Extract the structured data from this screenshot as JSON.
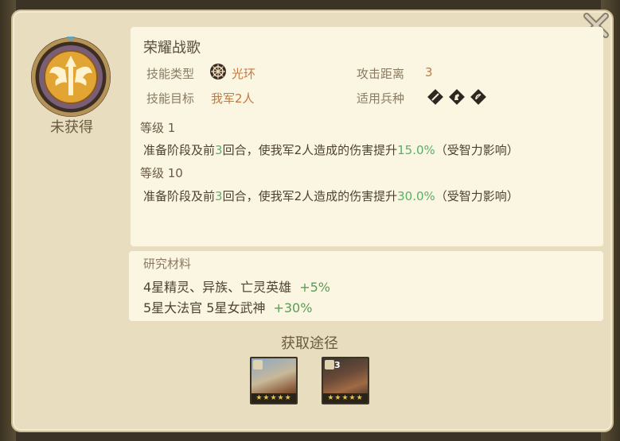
{
  "skill": {
    "name": "荣耀战歌",
    "status": "未获得",
    "type_label": "技能类型",
    "type_value": "光环",
    "range_label": "攻击距离",
    "range_value": "3",
    "target_label": "技能目标",
    "target_value": "我军2人",
    "troop_label": "适用兵种",
    "troop_icons": [
      "sword-icon",
      "horse-icon",
      "bow-icon"
    ]
  },
  "levels": [
    {
      "label": "等级 1",
      "pre": "准备阶段及前",
      "rounds": "3",
      "mid": "回合，使我军2人造成的伤害提升",
      "pct": "15.0%",
      "post": "（受智力影响）"
    },
    {
      "label": "等级 10",
      "pre": "准备阶段及前",
      "rounds": "3",
      "mid": "回合，使我军2人造成的伤害提升",
      "pct": "30.0%",
      "post": "（受智力影响）"
    }
  ],
  "research": {
    "title": "研究材料",
    "items": [
      {
        "text": "4星精灵、异族、亡灵英雄",
        "bonus": "+5%"
      },
      {
        "text": "5星大法官 5星女武神",
        "bonus": "+30%"
      }
    ]
  },
  "acquire": {
    "title": "获取途径",
    "heroes": [
      {
        "name": "hero-1",
        "level": "",
        "stars": "★★★★★",
        "class_icon": "sword-icon"
      },
      {
        "name": "hero-2",
        "level": "3",
        "stars": "★★★★★",
        "class_icon": "sword-icon"
      }
    ]
  },
  "colors": {
    "accent_orange": "#c4783e",
    "accent_green": "#58b068",
    "panel_bg": "#e9ddbf",
    "card_bg": "#fbf6e2"
  }
}
